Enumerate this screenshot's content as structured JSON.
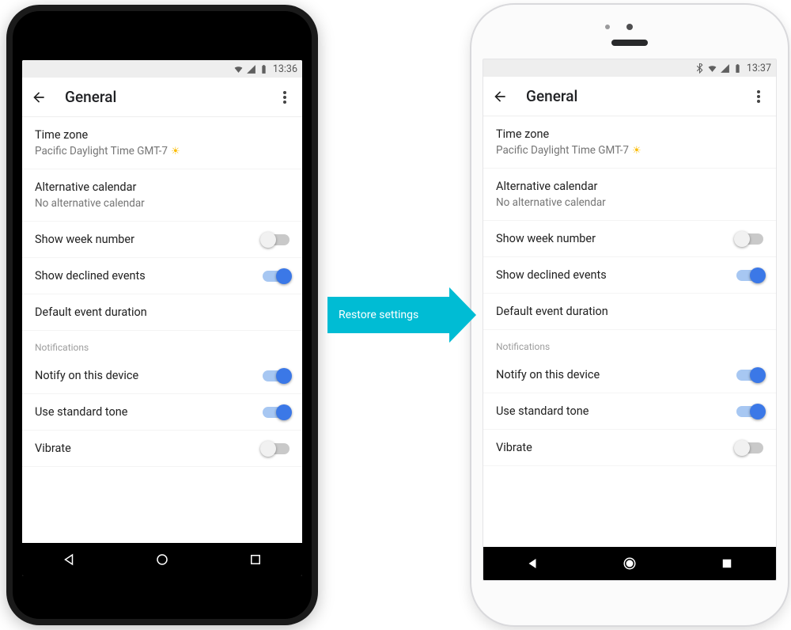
{
  "arrow_label": "Restore settings",
  "left": {
    "status": {
      "time": "13:36",
      "icons": [
        "wifi-icon",
        "signal-icon",
        "battery-icon"
      ]
    },
    "appbar": {
      "title": "General"
    },
    "settings": {
      "timezone_label": "Time zone",
      "timezone_value": "Pacific Daylight Time  GMT-7",
      "altcal_label": "Alternative calendar",
      "altcal_value": "No alternative calendar",
      "week_number_label": "Show week number",
      "week_number_on": false,
      "declined_label": "Show declined events",
      "declined_on": true,
      "default_duration_label": "Default event duration",
      "notifications_header": "Notifications",
      "notify_device_label": "Notify on this device",
      "notify_device_on": true,
      "standard_tone_label": "Use standard tone",
      "standard_tone_on": true,
      "vibrate_label": "Vibrate",
      "vibrate_on": false
    }
  },
  "right": {
    "status": {
      "time": "13:37",
      "icons": [
        "bluetooth-icon",
        "wifi-icon",
        "signal-icon",
        "battery-icon"
      ]
    },
    "appbar": {
      "title": "General"
    },
    "settings": {
      "timezone_label": "Time zone",
      "timezone_value": "Pacific Daylight Time  GMT-7",
      "altcal_label": "Alternative calendar",
      "altcal_value": "No alternative calendar",
      "week_number_label": "Show week number",
      "week_number_on": false,
      "declined_label": "Show declined events",
      "declined_on": true,
      "default_duration_label": "Default event duration",
      "notifications_header": "Notifications",
      "notify_device_label": "Notify on this device",
      "notify_device_on": true,
      "standard_tone_label": "Use standard tone",
      "standard_tone_on": true,
      "vibrate_label": "Vibrate",
      "vibrate_on": false
    }
  }
}
